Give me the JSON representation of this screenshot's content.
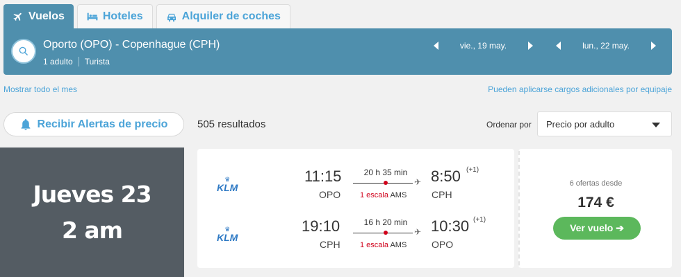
{
  "tabs": [
    {
      "label": "Vuelos",
      "icon": "airplane-icon"
    },
    {
      "label": "Hoteles",
      "icon": "bed-icon"
    },
    {
      "label": "Alquiler de coches",
      "icon": "car-icon"
    }
  ],
  "search": {
    "route": "Oporto (OPO) - Copenhague (CPH)",
    "passengers": "1 adulto",
    "cabin": "Turista",
    "depart_date": "vie., 19 may.",
    "return_date": "lun., 22 may."
  },
  "links": {
    "show_month": "Mostrar todo el mes",
    "baggage_note": "Pueden aplicarse cargos adicionales por equipaje"
  },
  "alerts_button": "Recibir Alertas de precio",
  "results_count": "505 resultados",
  "sort": {
    "label": "Ordenar por",
    "value": "Precio por adulto"
  },
  "overlay": {
    "line1": "Jueves 23",
    "line2": "2 am"
  },
  "flights": [
    {
      "airline": "KLM",
      "depart_time": "11:15",
      "depart_code": "OPO",
      "duration": "20 h 35 min",
      "stops": "1 escala",
      "via": "AMS",
      "arrive_time": "8:50",
      "arrive_plus": "(+1)",
      "arrive_code": "CPH"
    },
    {
      "airline": "KLM",
      "depart_time": "19:10",
      "depart_code": "CPH",
      "duration": "16 h 20 min",
      "stops": "1 escala",
      "via": "AMS",
      "arrive_time": "10:30",
      "arrive_plus": "(+1)",
      "arrive_code": "OPO"
    }
  ],
  "offer": {
    "offers_text": "6 ofertas desde",
    "price": "174 €",
    "cta": "Ver vuelo ➔"
  },
  "colors": {
    "accent": "#4f8fad",
    "link": "#4ca4d8",
    "cta": "#5cb85c",
    "stop": "#d0021b"
  }
}
